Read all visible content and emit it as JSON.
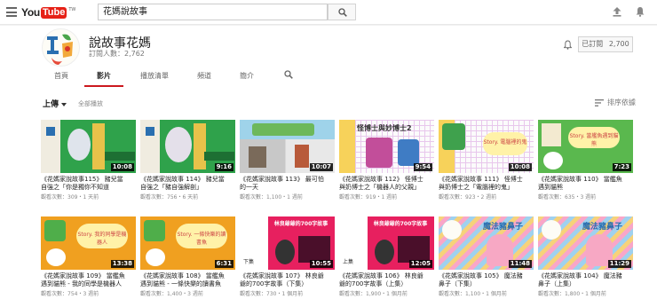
{
  "topbar": {
    "logo_you": "You",
    "logo_tube": "Tube",
    "logo_region": "TW",
    "search_value": "花媽說故事"
  },
  "channel": {
    "name": "說故事花媽",
    "subscribers": "訂閱人數：2,762",
    "subscribed_label": "已訂閱",
    "subscribed_count": "2,700"
  },
  "tabs": [
    {
      "label": "首頁"
    },
    {
      "label": "影片"
    },
    {
      "label": "播放清單"
    },
    {
      "label": "頻道"
    },
    {
      "label": "簡介"
    }
  ],
  "toolbar": {
    "uploads_label": "上傳",
    "play_all_label": "全部播放",
    "sort_label": "排序依據"
  },
  "videos": [
    {
      "title1": "《花媽家說故事115》 豬兒當",
      "title2": "自強之「你是獨你不知道",
      "meta": "觀看次數：309・1 天前",
      "duration": "10:08"
    },
    {
      "title1": "《花媽家說故事 114》 豬兒當",
      "title2": "自強之「豬自強解剖」",
      "meta": "觀看次數：756・6 天前",
      "duration": "9:16"
    },
    {
      "title1": "《花媽家說故事 113》 最可怕",
      "title2": "的一天",
      "meta": "觀看次數：1,100・1 週前",
      "duration": "10:07"
    },
    {
      "title1": "《花媽家說故事 112》 怪博士",
      "title2": "與奶博士之「機器人的父親」",
      "meta": "觀看次數：919・1 週前",
      "duration": "9:54"
    },
    {
      "title1": "《花媽家說故事 111》 怪博士",
      "title2": "與奶博士之「電腦裡的鬼」",
      "meta": "觀看次數：923・2 週前",
      "duration": "10:08"
    },
    {
      "title1": "《花媽家說故事 110》 當艦魚",
      "title2": "遇到貓熊",
      "meta": "觀看次數：635・3 週前",
      "duration": "7:23"
    },
    {
      "title1": "《花媽家說故事 109》 當艦魚",
      "title2": "遇到貓熊 - 我的同學是機器人",
      "meta": "觀看次數：754・3 週前",
      "duration": "13:38"
    },
    {
      "title1": "《花媽家說故事 108》 當艦魚",
      "title2": "遇到貓熊 - 一條快樂的讀書魚",
      "meta": "觀看次數：1,400・3 週前",
      "duration": "6:31"
    },
    {
      "title1": "《花媽家說故事 107》 林良爺",
      "title2": "爺的700字故事（下集）",
      "meta": "觀看次數：730・1 個月前",
      "duration": "10:55"
    },
    {
      "title1": "《花媽家說故事 106》 林良爺",
      "title2": "爺的700字故事（上集）",
      "meta": "觀看次數：1,900・1 個月前",
      "duration": "12:05"
    },
    {
      "title1": "《花媽家說故事 105》 魔法豬",
      "title2": "鼻子（下集）",
      "meta": "觀看次數：1,100・1 個月前",
      "duration": "11:48"
    },
    {
      "title1": "《花媽家說故事 104》 魔法豬",
      "title2": "鼻子（上集）",
      "meta": "觀看次數：1,800・1 個月前",
      "duration": "11:29"
    }
  ],
  "thumb_texts": {
    "v4": "怪博士與妙博士2",
    "v5": "Story. 電腦裡的鬼",
    "v6": "Story. 當艦魚遇到貓熊",
    "v7": "Story. 我的同學是機器人",
    "v8": "Story. 一條快樂的讀書魚",
    "v9": "林良爺爺的700字故事",
    "v10": "林良爺爺的700字故事",
    "v9_part": "下集",
    "v10_part": "上集",
    "v11": "魔法豬鼻子",
    "v12": "魔法豬鼻子"
  },
  "icons": {
    "menu": "menu-icon",
    "search": "search-icon",
    "upload": "upload-icon",
    "bell": "bell-icon",
    "sort": "sort-icon"
  },
  "colors": {
    "brand_red": "#e62117",
    "active_tab": "#cc181e"
  }
}
